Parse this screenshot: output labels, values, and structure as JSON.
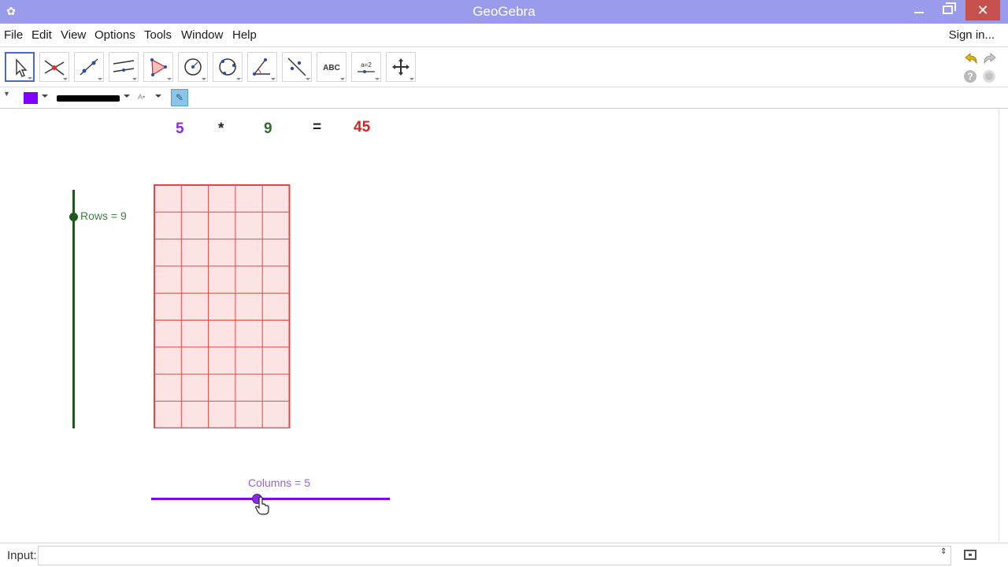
{
  "window": {
    "title": "GeoGebra",
    "close_glyph": "✕",
    "app_glyph": "✿"
  },
  "menu": {
    "items": [
      "File",
      "Edit",
      "View",
      "Options",
      "Tools",
      "Window",
      "Help"
    ],
    "sign_in": "Sign in..."
  },
  "toolbar": {
    "tools": [
      {
        "name": "move-tool-icon"
      },
      {
        "name": "intersect-tool-icon"
      },
      {
        "name": "line-tool-icon"
      },
      {
        "name": "parallel-line-tool-icon"
      },
      {
        "name": "polygon-tool-icon"
      },
      {
        "name": "circle-tool-icon"
      },
      {
        "name": "ellipse-tool-icon"
      },
      {
        "name": "angle-tool-icon"
      },
      {
        "name": "reflect-tool-icon"
      },
      {
        "name": "text-tool-icon",
        "text": "ABC"
      },
      {
        "name": "slider-tool-icon",
        "text": "a=2"
      },
      {
        "name": "move-graphics-view-tool-icon"
      }
    ],
    "selected_index": 0
  },
  "stylebar": {
    "color": "#7f00ff",
    "label_style": "A•"
  },
  "graphics": {
    "expression": {
      "columns": "5",
      "times": "*",
      "rows": "9",
      "equals": "=",
      "product": "45"
    },
    "colors": {
      "columns": "#8a2be2",
      "rows": "#2e6b2e",
      "product": "#d92020",
      "grid": "#e04848",
      "grid_fill": "#fde4e4"
    },
    "rows_slider": {
      "label": "Rows = 9",
      "value": 9,
      "min": 1,
      "max": 10
    },
    "columns_slider": {
      "label": "Columns = 5",
      "value": 5,
      "min": 1,
      "max": 10
    },
    "grid": {
      "columns": 5,
      "rows": 9
    }
  },
  "inputbar": {
    "label": "Input:",
    "value": "",
    "arrows": "⇕"
  }
}
